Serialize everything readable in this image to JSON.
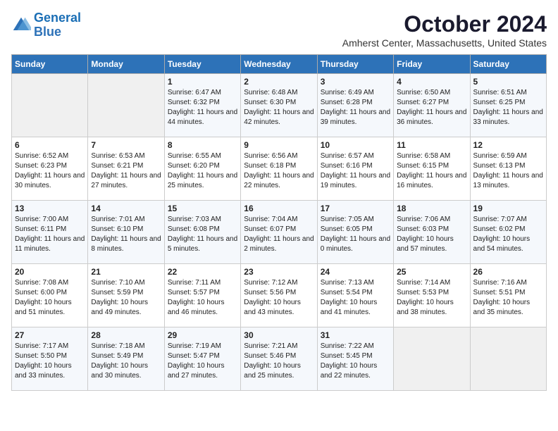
{
  "logo": {
    "line1": "General",
    "line2": "Blue"
  },
  "title": "October 2024",
  "location": "Amherst Center, Massachusetts, United States",
  "weekdays": [
    "Sunday",
    "Monday",
    "Tuesday",
    "Wednesday",
    "Thursday",
    "Friday",
    "Saturday"
  ],
  "weeks": [
    [
      {
        "day": "",
        "content": ""
      },
      {
        "day": "",
        "content": ""
      },
      {
        "day": "1",
        "content": "Sunrise: 6:47 AM\nSunset: 6:32 PM\nDaylight: 11 hours and 44 minutes."
      },
      {
        "day": "2",
        "content": "Sunrise: 6:48 AM\nSunset: 6:30 PM\nDaylight: 11 hours and 42 minutes."
      },
      {
        "day": "3",
        "content": "Sunrise: 6:49 AM\nSunset: 6:28 PM\nDaylight: 11 hours and 39 minutes."
      },
      {
        "day": "4",
        "content": "Sunrise: 6:50 AM\nSunset: 6:27 PM\nDaylight: 11 hours and 36 minutes."
      },
      {
        "day": "5",
        "content": "Sunrise: 6:51 AM\nSunset: 6:25 PM\nDaylight: 11 hours and 33 minutes."
      }
    ],
    [
      {
        "day": "6",
        "content": "Sunrise: 6:52 AM\nSunset: 6:23 PM\nDaylight: 11 hours and 30 minutes."
      },
      {
        "day": "7",
        "content": "Sunrise: 6:53 AM\nSunset: 6:21 PM\nDaylight: 11 hours and 27 minutes."
      },
      {
        "day": "8",
        "content": "Sunrise: 6:55 AM\nSunset: 6:20 PM\nDaylight: 11 hours and 25 minutes."
      },
      {
        "day": "9",
        "content": "Sunrise: 6:56 AM\nSunset: 6:18 PM\nDaylight: 11 hours and 22 minutes."
      },
      {
        "day": "10",
        "content": "Sunrise: 6:57 AM\nSunset: 6:16 PM\nDaylight: 11 hours and 19 minutes."
      },
      {
        "day": "11",
        "content": "Sunrise: 6:58 AM\nSunset: 6:15 PM\nDaylight: 11 hours and 16 minutes."
      },
      {
        "day": "12",
        "content": "Sunrise: 6:59 AM\nSunset: 6:13 PM\nDaylight: 11 hours and 13 minutes."
      }
    ],
    [
      {
        "day": "13",
        "content": "Sunrise: 7:00 AM\nSunset: 6:11 PM\nDaylight: 11 hours and 11 minutes."
      },
      {
        "day": "14",
        "content": "Sunrise: 7:01 AM\nSunset: 6:10 PM\nDaylight: 11 hours and 8 minutes."
      },
      {
        "day": "15",
        "content": "Sunrise: 7:03 AM\nSunset: 6:08 PM\nDaylight: 11 hours and 5 minutes."
      },
      {
        "day": "16",
        "content": "Sunrise: 7:04 AM\nSunset: 6:07 PM\nDaylight: 11 hours and 2 minutes."
      },
      {
        "day": "17",
        "content": "Sunrise: 7:05 AM\nSunset: 6:05 PM\nDaylight: 11 hours and 0 minutes."
      },
      {
        "day": "18",
        "content": "Sunrise: 7:06 AM\nSunset: 6:03 PM\nDaylight: 10 hours and 57 minutes."
      },
      {
        "day": "19",
        "content": "Sunrise: 7:07 AM\nSunset: 6:02 PM\nDaylight: 10 hours and 54 minutes."
      }
    ],
    [
      {
        "day": "20",
        "content": "Sunrise: 7:08 AM\nSunset: 6:00 PM\nDaylight: 10 hours and 51 minutes."
      },
      {
        "day": "21",
        "content": "Sunrise: 7:10 AM\nSunset: 5:59 PM\nDaylight: 10 hours and 49 minutes."
      },
      {
        "day": "22",
        "content": "Sunrise: 7:11 AM\nSunset: 5:57 PM\nDaylight: 10 hours and 46 minutes."
      },
      {
        "day": "23",
        "content": "Sunrise: 7:12 AM\nSunset: 5:56 PM\nDaylight: 10 hours and 43 minutes."
      },
      {
        "day": "24",
        "content": "Sunrise: 7:13 AM\nSunset: 5:54 PM\nDaylight: 10 hours and 41 minutes."
      },
      {
        "day": "25",
        "content": "Sunrise: 7:14 AM\nSunset: 5:53 PM\nDaylight: 10 hours and 38 minutes."
      },
      {
        "day": "26",
        "content": "Sunrise: 7:16 AM\nSunset: 5:51 PM\nDaylight: 10 hours and 35 minutes."
      }
    ],
    [
      {
        "day": "27",
        "content": "Sunrise: 7:17 AM\nSunset: 5:50 PM\nDaylight: 10 hours and 33 minutes."
      },
      {
        "day": "28",
        "content": "Sunrise: 7:18 AM\nSunset: 5:49 PM\nDaylight: 10 hours and 30 minutes."
      },
      {
        "day": "29",
        "content": "Sunrise: 7:19 AM\nSunset: 5:47 PM\nDaylight: 10 hours and 27 minutes."
      },
      {
        "day": "30",
        "content": "Sunrise: 7:21 AM\nSunset: 5:46 PM\nDaylight: 10 hours and 25 minutes."
      },
      {
        "day": "31",
        "content": "Sunrise: 7:22 AM\nSunset: 5:45 PM\nDaylight: 10 hours and 22 minutes."
      },
      {
        "day": "",
        "content": ""
      },
      {
        "day": "",
        "content": ""
      }
    ]
  ]
}
